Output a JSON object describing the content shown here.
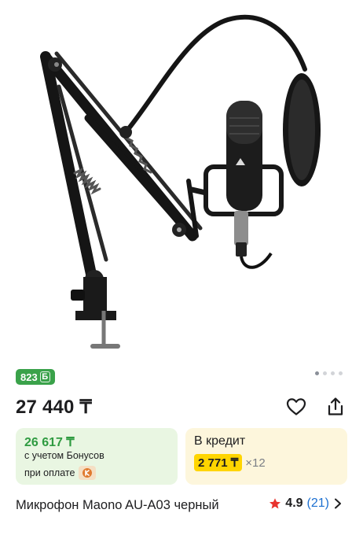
{
  "product": {
    "bonus_badge": "823",
    "bonus_symbol": "Б",
    "price": "27 440 ₸",
    "title": "Микрофон Maono AU-A03 черный",
    "rating": "4.9",
    "reviews": "(21)"
  },
  "bonus_card": {
    "amount": "26 617 ₸",
    "line1": "с учетом Бонусов",
    "line2": "при оплате"
  },
  "credit_card": {
    "title": "В кредит",
    "monthly": "2 771 ₸",
    "months": "×12"
  },
  "gallery": {
    "total_images": 4,
    "current_index": 1
  },
  "icons": {
    "favorite": "heart-icon",
    "share": "share-icon",
    "rating": "star-icon",
    "more": "chevron-right-icon",
    "payment": "kaspi-pay-icon"
  },
  "colors": {
    "bonus_green": "#3aa24a",
    "credit_yellow": "#ffd500",
    "star_red": "#e8332e",
    "link_blue": "#1b6fd1"
  }
}
